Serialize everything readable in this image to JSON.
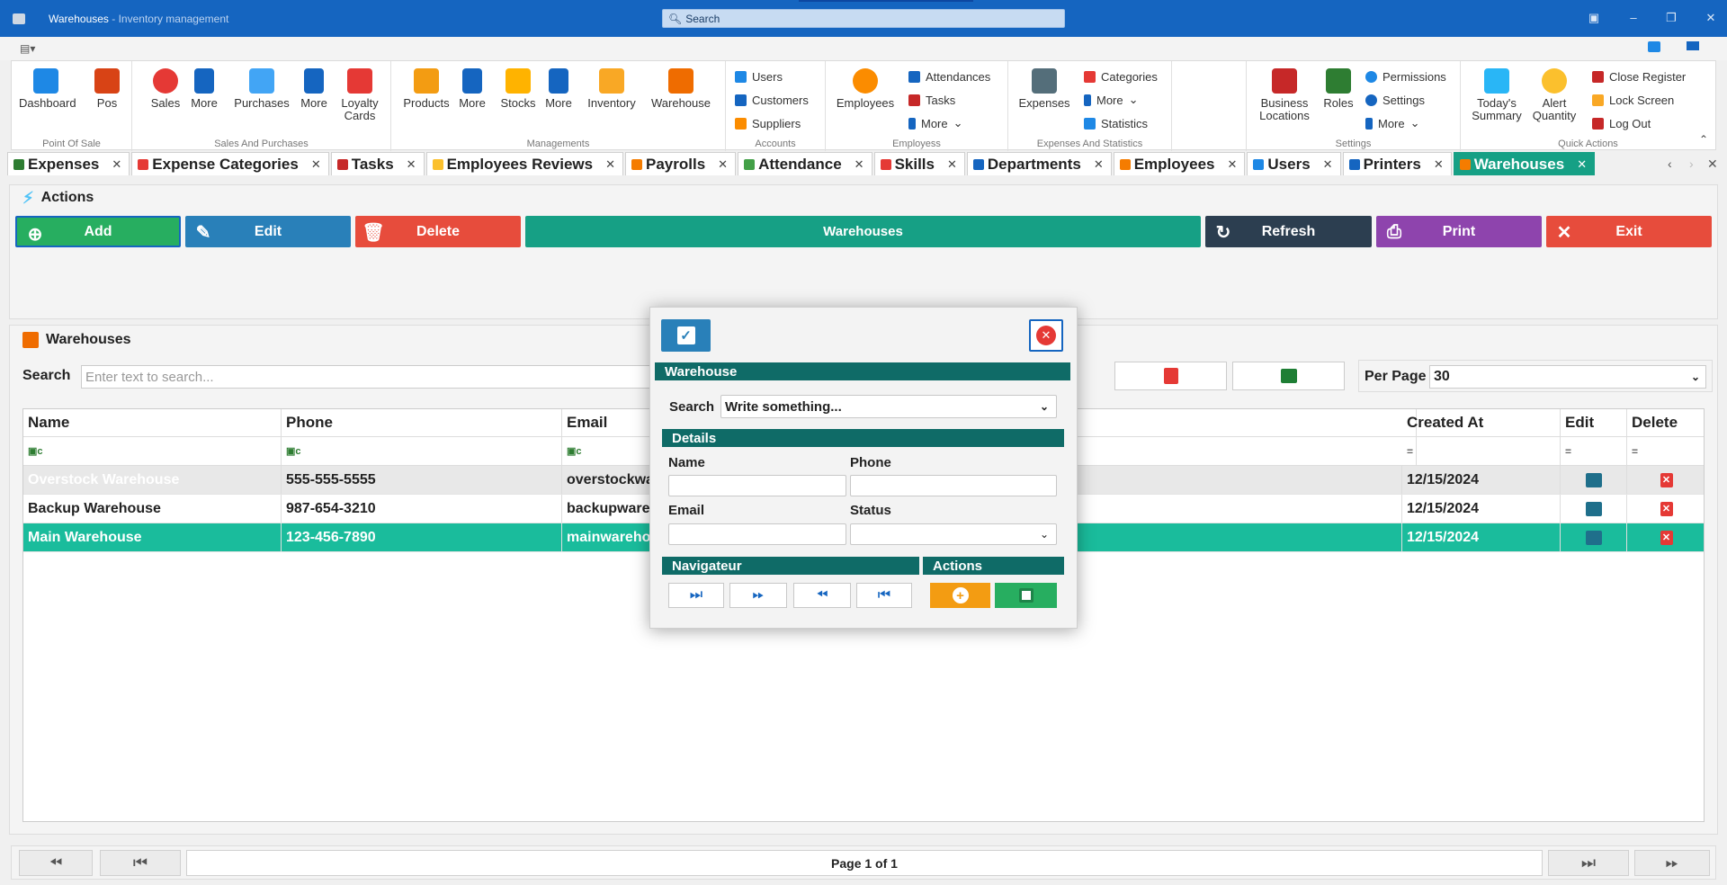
{
  "window": {
    "title": "Warehouses",
    "subtitle": "- Inventory management",
    "search_placeholder": "Search"
  },
  "ribbon": {
    "groups": [
      {
        "name": "Point Of Sale",
        "items": [
          "Dashboard",
          "Pos"
        ]
      },
      {
        "name": "Sales And Purchases",
        "items": [
          "Sales",
          "More",
          "Purchases",
          "More",
          "Loyalty Cards"
        ]
      },
      {
        "name": "Managements",
        "items": [
          "Products",
          "More",
          "Stocks",
          "More",
          "Inventory",
          "Warehouse"
        ]
      },
      {
        "name": "Accounts",
        "items": [
          "Users",
          "Customers",
          "Suppliers"
        ]
      },
      {
        "name": "Employess",
        "items": [
          "Employees",
          "Attendances",
          "Tasks",
          "More"
        ]
      },
      {
        "name": "Expenses And Statistics",
        "items": [
          "Expenses",
          "Categories",
          "More",
          "Statistics"
        ]
      },
      {
        "name": "Settings",
        "items": [
          "Business Locations",
          "Roles",
          "Permissions",
          "Settings",
          "More"
        ]
      },
      {
        "name": "Quick Actions",
        "items": [
          "Today's Summary",
          "Alert Quantity",
          "Close Register",
          "Lock Screen",
          "Log Out"
        ]
      }
    ]
  },
  "tabs": [
    {
      "label": "Expenses",
      "color": "#2e7d32"
    },
    {
      "label": "Expense Categories",
      "color": "#e53935"
    },
    {
      "label": "Tasks",
      "color": "#c62828"
    },
    {
      "label": "Employees Reviews",
      "color": "#fbc02d"
    },
    {
      "label": "Payrolls",
      "color": "#f57c00"
    },
    {
      "label": "Attendance",
      "color": "#43a047"
    },
    {
      "label": "Skills",
      "color": "#e53935"
    },
    {
      "label": "Departments",
      "color": "#1565c0"
    },
    {
      "label": "Employees",
      "color": "#f57c00"
    },
    {
      "label": "Users",
      "color": "#1e88e5"
    },
    {
      "label": "Printers",
      "color": "#1565c0"
    },
    {
      "label": "Warehouses",
      "color": "#f57c00",
      "active": true
    }
  ],
  "actions": {
    "title": "Actions",
    "add": "Add",
    "edit": "Edit",
    "delete": "Delete",
    "module": "Warehouses",
    "refresh": "Refresh",
    "print": "Print",
    "exit": "Exit"
  },
  "list": {
    "title": "Warehouses",
    "search_label": "Search",
    "search_placeholder": "Enter text to search...",
    "per_page_label": "Per Page",
    "per_page_value": "30",
    "columns": [
      "Name",
      "Phone",
      "Email",
      "Created At",
      "Edit",
      "Delete"
    ],
    "rows": [
      {
        "name": "Overstock Warehouse",
        "phone": "555-555-5555",
        "email": "overstockwa",
        "created": "12/15/2024"
      },
      {
        "name": "Backup Warehouse",
        "phone": "987-654-3210",
        "email": "backupware",
        "created": "12/15/2024"
      },
      {
        "name": "Main Warehouse",
        "phone": "123-456-7890",
        "email": "mainwareho",
        "created": "12/15/2024"
      }
    ],
    "page_text": "Page 1 of 1"
  },
  "modal": {
    "section_title": "Warehouse",
    "search_label": "Search",
    "search_value": "Write something...",
    "details_title": "Details",
    "name_label": "Name",
    "phone_label": "Phone",
    "email_label": "Email",
    "status_label": "Status",
    "navigator_title": "Navigateur",
    "actions_title": "Actions"
  },
  "colors": {
    "titlebar": "#1565c0",
    "accent_teal": "#16a085",
    "modal_header": "#0f6b67",
    "add": "#27ae60",
    "edit": "#2980b9",
    "delete": "#e74c3c",
    "refresh": "#2c3e50",
    "print": "#8e44ad",
    "exit": "#e74c3c"
  }
}
